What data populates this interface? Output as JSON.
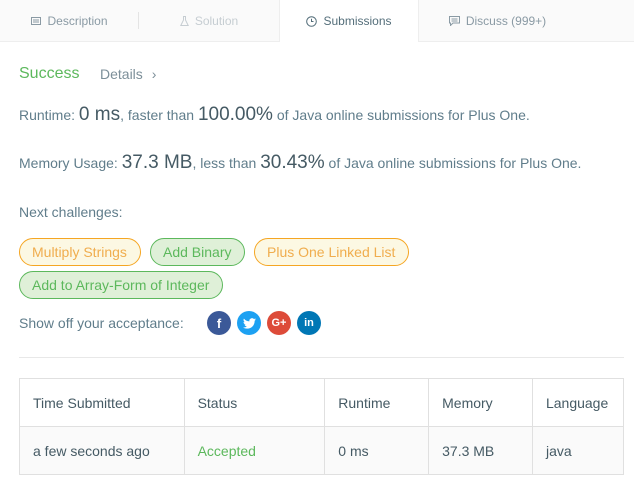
{
  "tabs": [
    {
      "label": "Description",
      "icon": "description-icon"
    },
    {
      "label": "Solution",
      "icon": "flask-icon"
    },
    {
      "label": "Submissions",
      "icon": "clock-icon"
    },
    {
      "label": "Discuss (999+)",
      "icon": "comment-icon"
    }
  ],
  "result": {
    "status": "Success",
    "details_label": "Details"
  },
  "runtime": {
    "label": "Runtime:",
    "value": "0 ms",
    "comparison": ", faster than",
    "percent": "100.00%",
    "suffix": "of Java online submissions for Plus One."
  },
  "memory": {
    "label": "Memory Usage:",
    "value": "37.3 MB",
    "comparison": ", less than",
    "percent": "30.43%",
    "suffix": "of Java online submissions for Plus One."
  },
  "next_challenges": {
    "label": "Next challenges:",
    "items": [
      {
        "label": "Multiply Strings",
        "difficulty_color": "#f0ad4e"
      },
      {
        "label": "Add Binary",
        "difficulty_color": "#5cb85c"
      },
      {
        "label": "Plus One Linked List",
        "difficulty_color": "#f0ad4e"
      },
      {
        "label": "Add to Array-Form of Integer",
        "difficulty_color": "#5cb85c"
      }
    ]
  },
  "share": {
    "label": "Show off your acceptance:",
    "icons": [
      "facebook-icon",
      "twitter-icon",
      "google-plus-icon",
      "linkedin-icon"
    ]
  },
  "table": {
    "headers": [
      "Time Submitted",
      "Status",
      "Runtime",
      "Memory",
      "Language"
    ],
    "rows": [
      [
        "a few seconds ago",
        "Accepted",
        "0 ms",
        "37.3 MB",
        "java"
      ]
    ]
  },
  "colors": {
    "success": "#5cb85c",
    "medium": "#f0ad4e"
  }
}
